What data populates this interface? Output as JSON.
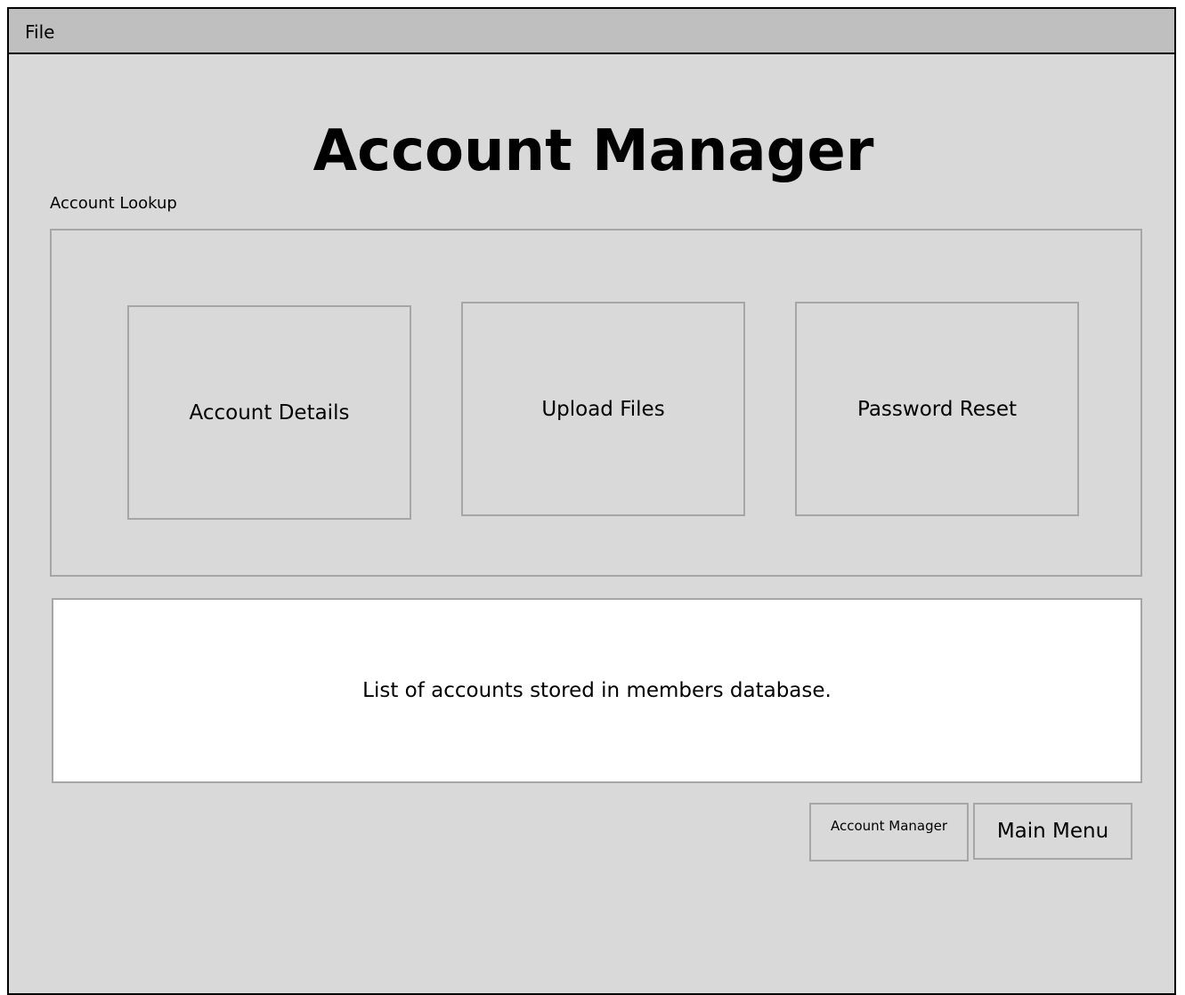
{
  "menubar": {
    "items": [
      {
        "label": "File"
      }
    ]
  },
  "page": {
    "title": "Account Manager"
  },
  "lookup": {
    "label": "Account Lookup",
    "actions": [
      {
        "label": "Account Details"
      },
      {
        "label": "Upload Files"
      },
      {
        "label": "Password Reset"
      }
    ]
  },
  "accounts": {
    "list_text": "List of accounts stored in members database."
  },
  "footer": {
    "account_manager_label": "Account Manager",
    "main_menu_label": "Main Menu"
  },
  "colors": {
    "window_background": "#d9d9d9",
    "menubar_background": "#bfbfbf",
    "box_border": "#a6a6a6",
    "list_background": "#ffffff"
  }
}
